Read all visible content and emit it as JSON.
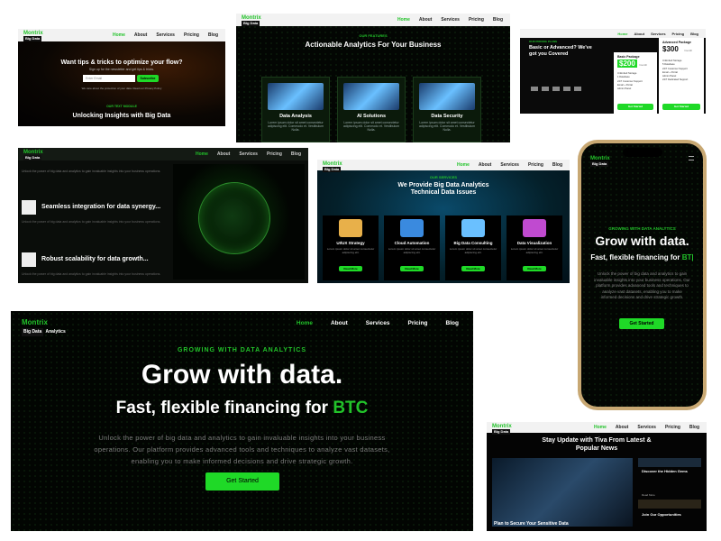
{
  "nav": {
    "home": "Home",
    "about": "About",
    "services": "Services",
    "pricing": "Pricing",
    "blog": "Blog"
  },
  "logo": {
    "name": "Montrix",
    "tag": "Big Data",
    "sub": "Analytics"
  },
  "tile_newsletter": {
    "heading": "Want tips & tricks to optimize your flow?",
    "sub": "Sign up for the newsletter and get tips & tricks.",
    "email_placeholder": "Enter Email",
    "button": "Subscribe",
    "privacy": "We care about the protection of your data. Read our Privacy Policy",
    "eyebrow": "OUR TEXT MODULE",
    "title": "Unlocking Insights with Big Data"
  },
  "tile_features": {
    "eyebrow": "OUR FEATURES",
    "title": "Actionable Analytics For Your Business",
    "cards": [
      {
        "title": "Data Analysis",
        "desc": "Lorem ipsum dolor sit amet consectetur adipiscing elit. Commodo et. Vestibulum Nulla."
      },
      {
        "title": "AI Solutions",
        "desc": "Lorem ipsum dolor sit amet consectetur adipiscing elit. Commodo et. Vestibulum Nulla."
      },
      {
        "title": "Data Security",
        "desc": "Lorem ipsum dolor sit amet consectetur adipiscing elit. Commodo et. Vestibulum Nulla."
      }
    ]
  },
  "tile_pricing": {
    "eyebrow": "OUR PRICING PLANS",
    "title": "Basic or Advanced? We've got you Covered",
    "basic": {
      "name": "Basic Package",
      "price": "$200",
      "period": "/month",
      "button": "Get Started"
    },
    "advanced": {
      "name": "Advanced Package",
      "price": "$300",
      "period": "/month",
      "button": "Get Started"
    },
    "basic_features": [
      "Unlimited Storage",
      "1 Database",
      "24/7 Customer Support",
      "Email + Portal",
      "Admin Panel"
    ],
    "advanced_features": [
      "Unlimited Storage",
      "5 Database",
      "24/7 Customer Support",
      "Email + Portal",
      "Admin Panel",
      "24/7 Dedicated Support"
    ]
  },
  "tile_integration": {
    "intro": "Unlock the power of big data and analytics to gain invaluable insights into your business operations.",
    "item1": "Seamless integration for data synergy...",
    "item1_desc": "Unlock the power of big data and analytics to gain invaluable insights into your business operations.",
    "item2": "Robust scalability for data growth...",
    "item2_desc": "Unlock the power of big data and analytics to gain invaluable insights into your business operations."
  },
  "tile_services": {
    "eyebrow": "OUR SERVICES",
    "title": "We Provide Big Data Analytics Technical Data Issues",
    "cards": [
      {
        "title": "UI/UX Strategy",
        "button": "Read More"
      },
      {
        "title": "Cloud Automation",
        "button": "Read More"
      },
      {
        "title": "Big Data Consulting",
        "button": "Read More"
      },
      {
        "title": "Data Visualization",
        "button": "Read More"
      }
    ],
    "card_desc": "Lorem ipsum dolor sit amet consectetur adipiscing elit."
  },
  "tile_mobile": {
    "eyebrow": "GROWING WITH DATA ANALYTICS",
    "headline": "Grow with data.",
    "subhead": "Fast, flexible financing for",
    "accent": "BT|",
    "body": "Unlock the power of big data and analytics to gain invaluable insights into your business operations. Our platform provides advanced tools and techniques to analyze vast datasets, enabling you to make informed decisions and drive strategic growth.",
    "button": "Get Started"
  },
  "tile_hero": {
    "eyebrow": "GROWING WITH DATA ANALYTICS",
    "headline": "Grow with data.",
    "subhead": "Fast, flexible financing for",
    "accent": "BTC",
    "body": "Unlock the power of big data and analytics to gain invaluable insights into your business operations. Our platform provides advanced tools and techniques to analyze vast datasets, enabling you to make informed decisions and drive strategic growth.",
    "button": "Get Started"
  },
  "tile_blog": {
    "title": "Stay Update with Tiva From Latest & Popular News",
    "post1": "Discover the Hidden Gems",
    "post2": "Join Our Opportunities",
    "post3": "Plan to Secure Your Sensitive Data",
    "read_more": "Read More"
  },
  "colors": {
    "accent": "#1fd927",
    "background": "#050805",
    "nav": "#f2f2f2"
  }
}
